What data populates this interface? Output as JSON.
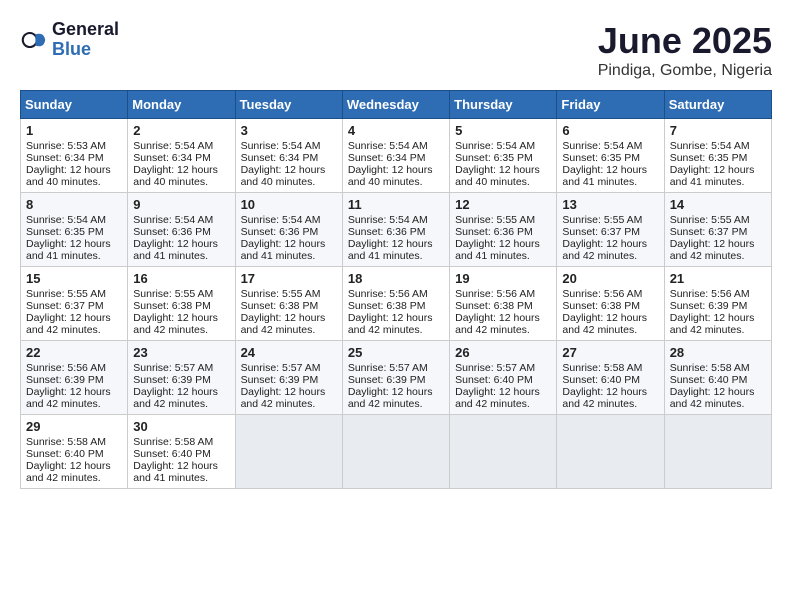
{
  "logo": {
    "general": "General",
    "blue": "Blue"
  },
  "title": "June 2025",
  "location": "Pindiga, Gombe, Nigeria",
  "days": [
    "Sunday",
    "Monday",
    "Tuesday",
    "Wednesday",
    "Thursday",
    "Friday",
    "Saturday"
  ],
  "weeks": [
    [
      {
        "day": 1,
        "sunrise": "5:53 AM",
        "sunset": "6:34 PM",
        "daylight": "12 hours and 40 minutes."
      },
      {
        "day": 2,
        "sunrise": "5:54 AM",
        "sunset": "6:34 PM",
        "daylight": "12 hours and 40 minutes."
      },
      {
        "day": 3,
        "sunrise": "5:54 AM",
        "sunset": "6:34 PM",
        "daylight": "12 hours and 40 minutes."
      },
      {
        "day": 4,
        "sunrise": "5:54 AM",
        "sunset": "6:34 PM",
        "daylight": "12 hours and 40 minutes."
      },
      {
        "day": 5,
        "sunrise": "5:54 AM",
        "sunset": "6:35 PM",
        "daylight": "12 hours and 40 minutes."
      },
      {
        "day": 6,
        "sunrise": "5:54 AM",
        "sunset": "6:35 PM",
        "daylight": "12 hours and 41 minutes."
      },
      {
        "day": 7,
        "sunrise": "5:54 AM",
        "sunset": "6:35 PM",
        "daylight": "12 hours and 41 minutes."
      }
    ],
    [
      {
        "day": 8,
        "sunrise": "5:54 AM",
        "sunset": "6:35 PM",
        "daylight": "12 hours and 41 minutes."
      },
      {
        "day": 9,
        "sunrise": "5:54 AM",
        "sunset": "6:36 PM",
        "daylight": "12 hours and 41 minutes."
      },
      {
        "day": 10,
        "sunrise": "5:54 AM",
        "sunset": "6:36 PM",
        "daylight": "12 hours and 41 minutes."
      },
      {
        "day": 11,
        "sunrise": "5:54 AM",
        "sunset": "6:36 PM",
        "daylight": "12 hours and 41 minutes."
      },
      {
        "day": 12,
        "sunrise": "5:55 AM",
        "sunset": "6:36 PM",
        "daylight": "12 hours and 41 minutes."
      },
      {
        "day": 13,
        "sunrise": "5:55 AM",
        "sunset": "6:37 PM",
        "daylight": "12 hours and 42 minutes."
      },
      {
        "day": 14,
        "sunrise": "5:55 AM",
        "sunset": "6:37 PM",
        "daylight": "12 hours and 42 minutes."
      }
    ],
    [
      {
        "day": 15,
        "sunrise": "5:55 AM",
        "sunset": "6:37 PM",
        "daylight": "12 hours and 42 minutes."
      },
      {
        "day": 16,
        "sunrise": "5:55 AM",
        "sunset": "6:38 PM",
        "daylight": "12 hours and 42 minutes."
      },
      {
        "day": 17,
        "sunrise": "5:55 AM",
        "sunset": "6:38 PM",
        "daylight": "12 hours and 42 minutes."
      },
      {
        "day": 18,
        "sunrise": "5:56 AM",
        "sunset": "6:38 PM",
        "daylight": "12 hours and 42 minutes."
      },
      {
        "day": 19,
        "sunrise": "5:56 AM",
        "sunset": "6:38 PM",
        "daylight": "12 hours and 42 minutes."
      },
      {
        "day": 20,
        "sunrise": "5:56 AM",
        "sunset": "6:38 PM",
        "daylight": "12 hours and 42 minutes."
      },
      {
        "day": 21,
        "sunrise": "5:56 AM",
        "sunset": "6:39 PM",
        "daylight": "12 hours and 42 minutes."
      }
    ],
    [
      {
        "day": 22,
        "sunrise": "5:56 AM",
        "sunset": "6:39 PM",
        "daylight": "12 hours and 42 minutes."
      },
      {
        "day": 23,
        "sunrise": "5:57 AM",
        "sunset": "6:39 PM",
        "daylight": "12 hours and 42 minutes."
      },
      {
        "day": 24,
        "sunrise": "5:57 AM",
        "sunset": "6:39 PM",
        "daylight": "12 hours and 42 minutes."
      },
      {
        "day": 25,
        "sunrise": "5:57 AM",
        "sunset": "6:39 PM",
        "daylight": "12 hours and 42 minutes."
      },
      {
        "day": 26,
        "sunrise": "5:57 AM",
        "sunset": "6:40 PM",
        "daylight": "12 hours and 42 minutes."
      },
      {
        "day": 27,
        "sunrise": "5:58 AM",
        "sunset": "6:40 PM",
        "daylight": "12 hours and 42 minutes."
      },
      {
        "day": 28,
        "sunrise": "5:58 AM",
        "sunset": "6:40 PM",
        "daylight": "12 hours and 42 minutes."
      }
    ],
    [
      {
        "day": 29,
        "sunrise": "5:58 AM",
        "sunset": "6:40 PM",
        "daylight": "12 hours and 42 minutes."
      },
      {
        "day": 30,
        "sunrise": "5:58 AM",
        "sunset": "6:40 PM",
        "daylight": "12 hours and 41 minutes."
      },
      null,
      null,
      null,
      null,
      null
    ]
  ]
}
